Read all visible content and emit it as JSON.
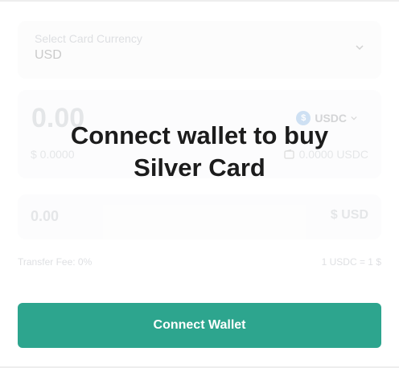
{
  "form": {
    "currency_label": "Select Card Currency",
    "currency_value": "USD",
    "amount": "0.00",
    "amount_usd": "$ 0.0000",
    "token": "USDC",
    "balance": "0.0000 USDC",
    "receive_amount": "0.00",
    "receive_unit": "$ USD",
    "fee": "Transfer Fee: 0%",
    "rate": "1 USDC = 1 $"
  },
  "overlay": {
    "line1": "Connect wallet to buy",
    "line2": "Silver Card"
  },
  "button": {
    "label": "Connect Wallet"
  },
  "colors": {
    "accent": "#2da58e",
    "usdc": "#2775ca"
  }
}
